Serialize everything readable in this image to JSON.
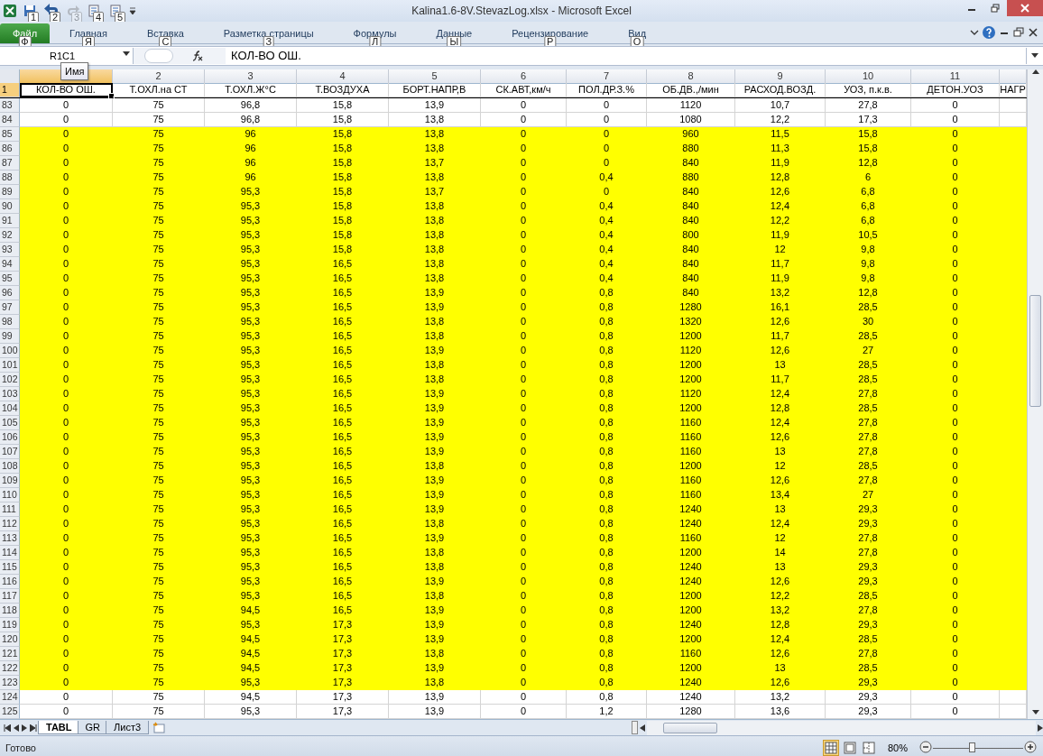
{
  "window": {
    "title": "Kalina1.6-8V.StevazLog.xlsx  -  Microsoft Excel"
  },
  "quick_access": [
    {
      "kind": "save",
      "keytip": "1",
      "disabled": false
    },
    {
      "kind": "undo",
      "keytip": "2",
      "disabled": false
    },
    {
      "kind": "redo",
      "keytip": "3",
      "disabled": true
    },
    {
      "kind": "sort",
      "keytip": "4",
      "disabled": false
    },
    {
      "kind": "sort",
      "keytip": "5",
      "disabled": false
    }
  ],
  "ribbon_tabs": [
    {
      "label": "Файл",
      "keytip": "Ф",
      "selected": true
    },
    {
      "label": "Главная",
      "keytip": "Я",
      "selected": false
    },
    {
      "label": "Вставка",
      "keytip": "С",
      "selected": false
    },
    {
      "label": "Разметка страницы",
      "keytip": "З",
      "selected": false
    },
    {
      "label": "Формулы",
      "keytip": "Л",
      "selected": false
    },
    {
      "label": "Данные",
      "keytip": "Ы",
      "selected": false
    },
    {
      "label": "Рецензирование",
      "keytip": "Р",
      "selected": false
    },
    {
      "label": "Вид",
      "keytip": "О",
      "selected": false
    }
  ],
  "name_box": {
    "value": "R1C1",
    "tooltip": "Имя"
  },
  "formula_bar": {
    "value": "КОЛ-ВО ОШ."
  },
  "columns": [
    {
      "title": "КОЛ-ВО ОШ.",
      "selected": true
    },
    {
      "number": "2",
      "title": "Т.ОХЛ.на СТ",
      "selected": false
    },
    {
      "number": "3",
      "title": "Т.ОХЛ.Ж°С",
      "selected": false
    },
    {
      "number": "4",
      "title": "Т.ВОЗДУХА",
      "selected": false
    },
    {
      "number": "5",
      "title": "БОРТ.НАПР,В",
      "selected": false
    },
    {
      "number": "6",
      "title": "СК.АВТ,км/ч",
      "selected": false
    },
    {
      "number": "7",
      "title": "ПОЛ.ДР.З.%",
      "selected": false
    },
    {
      "number": "8",
      "title": "ОБ.ДВ.,/мин",
      "selected": false
    },
    {
      "number": "9",
      "title": "РАСХОД.ВОЗД.",
      "selected": false
    },
    {
      "number": "10",
      "title": "УОЗ, п.к.в.",
      "selected": false
    },
    {
      "number": "11",
      "title": "ДЕТОН.УОЗ",
      "selected": false
    },
    {
      "title": "НАГР",
      "selected": false
    }
  ],
  "header_row": {
    "number": "1",
    "selected": true
  },
  "rows": [
    {
      "number": "83",
      "highlighted": false,
      "cells": [
        "0",
        "75",
        "96,8",
        "15,8",
        "13,9",
        "0",
        "0",
        "1120",
        "10,7",
        "27,8",
        "0"
      ]
    },
    {
      "number": "84",
      "highlighted": false,
      "cells": [
        "0",
        "75",
        "96,8",
        "15,8",
        "13,8",
        "0",
        "0",
        "1080",
        "12,2",
        "17,3",
        "0"
      ]
    },
    {
      "number": "85",
      "highlighted": true,
      "cells": [
        "0",
        "75",
        "96",
        "15,8",
        "13,8",
        "0",
        "0",
        "960",
        "11,5",
        "15,8",
        "0"
      ]
    },
    {
      "number": "86",
      "highlighted": true,
      "cells": [
        "0",
        "75",
        "96",
        "15,8",
        "13,8",
        "0",
        "0",
        "880",
        "11,3",
        "15,8",
        "0"
      ]
    },
    {
      "number": "87",
      "highlighted": true,
      "cells": [
        "0",
        "75",
        "96",
        "15,8",
        "13,7",
        "0",
        "0",
        "840",
        "11,9",
        "12,8",
        "0"
      ]
    },
    {
      "number": "88",
      "highlighted": true,
      "cells": [
        "0",
        "75",
        "96",
        "15,8",
        "13,8",
        "0",
        "0,4",
        "880",
        "12,8",
        "6",
        "0"
      ]
    },
    {
      "number": "89",
      "highlighted": true,
      "cells": [
        "0",
        "75",
        "95,3",
        "15,8",
        "13,7",
        "0",
        "0",
        "840",
        "12,6",
        "6,8",
        "0"
      ]
    },
    {
      "number": "90",
      "highlighted": true,
      "cells": [
        "0",
        "75",
        "95,3",
        "15,8",
        "13,8",
        "0",
        "0,4",
        "840",
        "12,4",
        "6,8",
        "0"
      ]
    },
    {
      "number": "91",
      "highlighted": true,
      "cells": [
        "0",
        "75",
        "95,3",
        "15,8",
        "13,8",
        "0",
        "0,4",
        "840",
        "12,2",
        "6,8",
        "0"
      ]
    },
    {
      "number": "92",
      "highlighted": true,
      "cells": [
        "0",
        "75",
        "95,3",
        "15,8",
        "13,8",
        "0",
        "0,4",
        "800",
        "11,9",
        "10,5",
        "0"
      ]
    },
    {
      "number": "93",
      "highlighted": true,
      "cells": [
        "0",
        "75",
        "95,3",
        "15,8",
        "13,8",
        "0",
        "0,4",
        "840",
        "12",
        "9,8",
        "0"
      ]
    },
    {
      "number": "94",
      "highlighted": true,
      "cells": [
        "0",
        "75",
        "95,3",
        "16,5",
        "13,8",
        "0",
        "0,4",
        "840",
        "11,7",
        "9,8",
        "0"
      ]
    },
    {
      "number": "95",
      "highlighted": true,
      "cells": [
        "0",
        "75",
        "95,3",
        "16,5",
        "13,8",
        "0",
        "0,4",
        "840",
        "11,9",
        "9,8",
        "0"
      ]
    },
    {
      "number": "96",
      "highlighted": true,
      "cells": [
        "0",
        "75",
        "95,3",
        "16,5",
        "13,9",
        "0",
        "0,8",
        "840",
        "13,2",
        "12,8",
        "0"
      ]
    },
    {
      "number": "97",
      "highlighted": true,
      "cells": [
        "0",
        "75",
        "95,3",
        "16,5",
        "13,9",
        "0",
        "0,8",
        "1280",
        "16,1",
        "28,5",
        "0"
      ]
    },
    {
      "number": "98",
      "highlighted": true,
      "cells": [
        "0",
        "75",
        "95,3",
        "16,5",
        "13,8",
        "0",
        "0,8",
        "1320",
        "12,6",
        "30",
        "0"
      ]
    },
    {
      "number": "99",
      "highlighted": true,
      "cells": [
        "0",
        "75",
        "95,3",
        "16,5",
        "13,8",
        "0",
        "0,8",
        "1200",
        "11,7",
        "28,5",
        "0"
      ]
    },
    {
      "number": "100",
      "highlighted": true,
      "cells": [
        "0",
        "75",
        "95,3",
        "16,5",
        "13,9",
        "0",
        "0,8",
        "1120",
        "12,6",
        "27",
        "0"
      ]
    },
    {
      "number": "101",
      "highlighted": true,
      "cells": [
        "0",
        "75",
        "95,3",
        "16,5",
        "13,8",
        "0",
        "0,8",
        "1200",
        "13",
        "28,5",
        "0"
      ]
    },
    {
      "number": "102",
      "highlighted": true,
      "cells": [
        "0",
        "75",
        "95,3",
        "16,5",
        "13,8",
        "0",
        "0,8",
        "1200",
        "11,7",
        "28,5",
        "0"
      ]
    },
    {
      "number": "103",
      "highlighted": true,
      "cells": [
        "0",
        "75",
        "95,3",
        "16,5",
        "13,9",
        "0",
        "0,8",
        "1120",
        "12,4",
        "27,8",
        "0"
      ]
    },
    {
      "number": "104",
      "highlighted": true,
      "cells": [
        "0",
        "75",
        "95,3",
        "16,5",
        "13,9",
        "0",
        "0,8",
        "1200",
        "12,8",
        "28,5",
        "0"
      ]
    },
    {
      "number": "105",
      "highlighted": true,
      "cells": [
        "0",
        "75",
        "95,3",
        "16,5",
        "13,9",
        "0",
        "0,8",
        "1160",
        "12,4",
        "27,8",
        "0"
      ]
    },
    {
      "number": "106",
      "highlighted": true,
      "cells": [
        "0",
        "75",
        "95,3",
        "16,5",
        "13,9",
        "0",
        "0,8",
        "1160",
        "12,6",
        "27,8",
        "0"
      ]
    },
    {
      "number": "107",
      "highlighted": true,
      "cells": [
        "0",
        "75",
        "95,3",
        "16,5",
        "13,9",
        "0",
        "0,8",
        "1160",
        "13",
        "27,8",
        "0"
      ]
    },
    {
      "number": "108",
      "highlighted": true,
      "cells": [
        "0",
        "75",
        "95,3",
        "16,5",
        "13,8",
        "0",
        "0,8",
        "1200",
        "12",
        "28,5",
        "0"
      ]
    },
    {
      "number": "109",
      "highlighted": true,
      "cells": [
        "0",
        "75",
        "95,3",
        "16,5",
        "13,9",
        "0",
        "0,8",
        "1160",
        "12,6",
        "27,8",
        "0"
      ]
    },
    {
      "number": "110",
      "highlighted": true,
      "cells": [
        "0",
        "75",
        "95,3",
        "16,5",
        "13,9",
        "0",
        "0,8",
        "1160",
        "13,4",
        "27",
        "0"
      ]
    },
    {
      "number": "111",
      "highlighted": true,
      "cells": [
        "0",
        "75",
        "95,3",
        "16,5",
        "13,9",
        "0",
        "0,8",
        "1240",
        "13",
        "29,3",
        "0"
      ]
    },
    {
      "number": "112",
      "highlighted": true,
      "cells": [
        "0",
        "75",
        "95,3",
        "16,5",
        "13,8",
        "0",
        "0,8",
        "1240",
        "12,4",
        "29,3",
        "0"
      ]
    },
    {
      "number": "113",
      "highlighted": true,
      "cells": [
        "0",
        "75",
        "95,3",
        "16,5",
        "13,9",
        "0",
        "0,8",
        "1160",
        "12",
        "27,8",
        "0"
      ]
    },
    {
      "number": "114",
      "highlighted": true,
      "cells": [
        "0",
        "75",
        "95,3",
        "16,5",
        "13,8",
        "0",
        "0,8",
        "1200",
        "14",
        "27,8",
        "0"
      ]
    },
    {
      "number": "115",
      "highlighted": true,
      "cells": [
        "0",
        "75",
        "95,3",
        "16,5",
        "13,8",
        "0",
        "0,8",
        "1240",
        "13",
        "29,3",
        "0"
      ]
    },
    {
      "number": "116",
      "highlighted": true,
      "cells": [
        "0",
        "75",
        "95,3",
        "16,5",
        "13,9",
        "0",
        "0,8",
        "1240",
        "12,6",
        "29,3",
        "0"
      ]
    },
    {
      "number": "117",
      "highlighted": true,
      "cells": [
        "0",
        "75",
        "95,3",
        "16,5",
        "13,8",
        "0",
        "0,8",
        "1200",
        "12,2",
        "28,5",
        "0"
      ]
    },
    {
      "number": "118",
      "highlighted": true,
      "cells": [
        "0",
        "75",
        "94,5",
        "16,5",
        "13,9",
        "0",
        "0,8",
        "1200",
        "13,2",
        "27,8",
        "0"
      ]
    },
    {
      "number": "119",
      "highlighted": true,
      "cells": [
        "0",
        "75",
        "95,3",
        "17,3",
        "13,9",
        "0",
        "0,8",
        "1240",
        "12,8",
        "29,3",
        "0"
      ]
    },
    {
      "number": "120",
      "highlighted": true,
      "cells": [
        "0",
        "75",
        "94,5",
        "17,3",
        "13,9",
        "0",
        "0,8",
        "1200",
        "12,4",
        "28,5",
        "0"
      ]
    },
    {
      "number": "121",
      "highlighted": true,
      "cells": [
        "0",
        "75",
        "94,5",
        "17,3",
        "13,8",
        "0",
        "0,8",
        "1160",
        "12,6",
        "27,8",
        "0"
      ]
    },
    {
      "number": "122",
      "highlighted": true,
      "cells": [
        "0",
        "75",
        "94,5",
        "17,3",
        "13,9",
        "0",
        "0,8",
        "1200",
        "13",
        "28,5",
        "0"
      ]
    },
    {
      "number": "123",
      "highlighted": true,
      "cells": [
        "0",
        "75",
        "95,3",
        "17,3",
        "13,8",
        "0",
        "0,8",
        "1240",
        "12,6",
        "29,3",
        "0"
      ]
    },
    {
      "number": "124",
      "highlighted": false,
      "cells": [
        "0",
        "75",
        "94,5",
        "17,3",
        "13,9",
        "0",
        "0,8",
        "1240",
        "13,2",
        "29,3",
        "0"
      ]
    },
    {
      "number": "125",
      "highlighted": false,
      "cells": [
        "0",
        "75",
        "95,3",
        "17,3",
        "13,9",
        "0",
        "1,2",
        "1280",
        "13,6",
        "29,3",
        "0"
      ]
    }
  ],
  "sheet_tabs": [
    {
      "label": "TABL",
      "selected": true
    },
    {
      "label": "GR",
      "selected": false
    },
    {
      "label": "Лист3",
      "selected": false
    }
  ],
  "status_bar": {
    "text": "Готово",
    "views": [
      {
        "kind": "normal",
        "selected": true
      },
      {
        "kind": "layout",
        "selected": false
      },
      {
        "kind": "pagebreak",
        "selected": false
      }
    ],
    "zoom": "80%",
    "zoom_slider": {
      "level": 0.43
    }
  }
}
